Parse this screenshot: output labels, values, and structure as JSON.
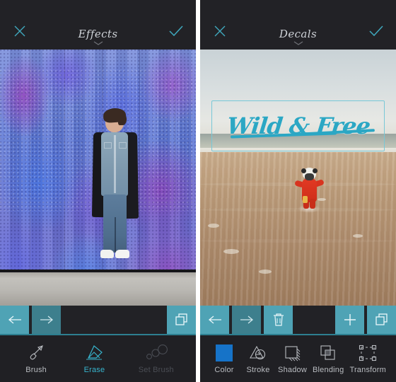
{
  "app": {
    "accent_cyan": "#37b4cd",
    "button_teal": "#4fa3b5",
    "button_teal_dim": "#3d7f8d",
    "panel_bg": "#222226",
    "toolbar_bg": "#202024"
  },
  "panels": [
    {
      "id": "effects",
      "header": {
        "close_icon": "close-icon",
        "title": "Effects",
        "chevron_icon": "chevron-down-icon",
        "confirm_icon": "check-icon"
      },
      "canvas": {
        "description": "Man standing in front of a blue and purple watercolor halftone wall",
        "subject": "man-in-denim-shirt-and-black-coat"
      },
      "action_bar": {
        "buttons": [
          {
            "name": "undo-button",
            "icon": "arrow-left-icon",
            "state": "enabled"
          },
          {
            "name": "redo-button",
            "icon": "arrow-right-icon",
            "state": "disabled"
          }
        ],
        "right_buttons": [
          {
            "name": "layers-button",
            "icon": "layers-icon",
            "state": "enabled"
          }
        ]
      },
      "toolbar": [
        {
          "name": "tool-brush",
          "label": "Brush",
          "icon": "brush-icon",
          "state": "normal"
        },
        {
          "name": "tool-erase",
          "label": "Erase",
          "icon": "eraser-icon",
          "state": "active"
        },
        {
          "name": "tool-set-brush",
          "label": "Set Brush",
          "icon": "set-brush-icon",
          "state": "disabled"
        }
      ]
    },
    {
      "id": "decals",
      "header": {
        "close_icon": "close-icon",
        "title": "Decals",
        "chevron_icon": "chevron-down-icon",
        "confirm_icon": "check-icon"
      },
      "canvas": {
        "description": "Child in a red rain suit running on a wet beach",
        "subject": "child-running-on-beach",
        "decal": {
          "text": "Wild & Free",
          "color": "#2ba7c4",
          "selected": true,
          "selection_border_color": "#78c8d7"
        }
      },
      "action_bar": {
        "buttons": [
          {
            "name": "undo-button",
            "icon": "arrow-left-icon",
            "state": "enabled"
          },
          {
            "name": "redo-button",
            "icon": "arrow-right-icon",
            "state": "disabled"
          },
          {
            "name": "delete-button",
            "icon": "trash-icon",
            "state": "enabled"
          }
        ],
        "right_buttons": [
          {
            "name": "add-decal-button",
            "icon": "plus-icon",
            "state": "enabled"
          },
          {
            "name": "layers-button",
            "icon": "layers-icon",
            "state": "enabled"
          }
        ]
      },
      "toolbar": [
        {
          "name": "tool-color",
          "label": "Color",
          "icon": "color-swatch-icon",
          "state": "normal",
          "swatch": "#1673c8"
        },
        {
          "name": "tool-stroke",
          "label": "Stroke",
          "icon": "stroke-icon",
          "state": "normal"
        },
        {
          "name": "tool-shadow",
          "label": "Shadow",
          "icon": "shadow-icon",
          "state": "normal"
        },
        {
          "name": "tool-blending",
          "label": "Blending",
          "icon": "blending-icon",
          "state": "normal"
        },
        {
          "name": "tool-transform",
          "label": "Transform",
          "icon": "transform-icon",
          "state": "normal"
        }
      ]
    }
  ]
}
